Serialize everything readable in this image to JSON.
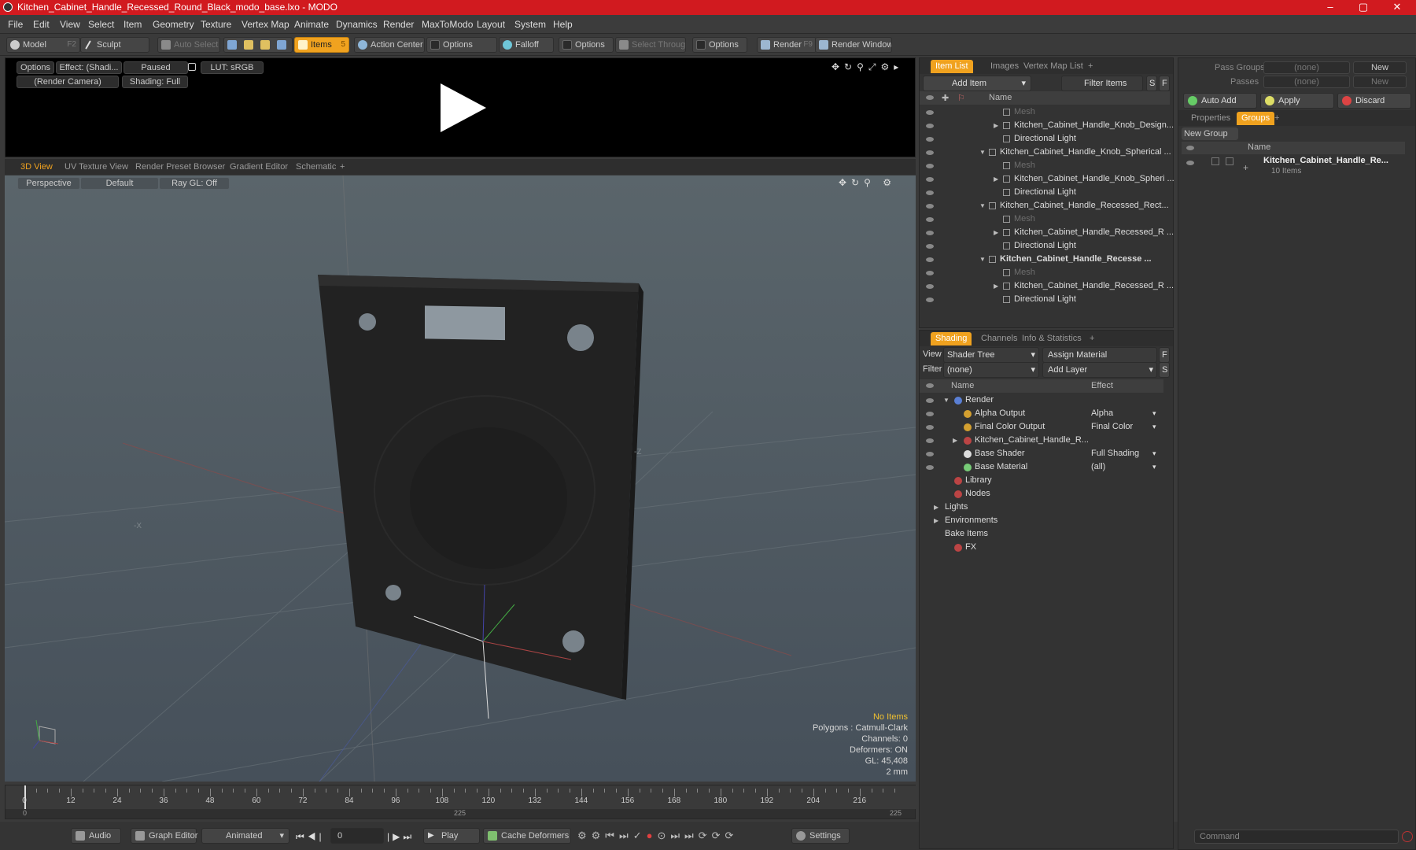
{
  "window": {
    "title": "Kitchen_Cabinet_Handle_Recessed_Round_Black_modo_base.lxo - MODO",
    "minimize": "–",
    "maximize": "▢",
    "close": "✕"
  },
  "menu": [
    "File",
    "Edit",
    "View",
    "Select",
    "Item",
    "Geometry",
    "Texture",
    "Vertex Map",
    "Animate",
    "Dynamics",
    "Render",
    "MaxToModo",
    "Layout",
    "System",
    "Help"
  ],
  "toolbar": {
    "model": "Model",
    "model_key": "F2",
    "sculpt": "Sculpt",
    "auto_select": "Auto Select",
    "items": "Items",
    "items_key": "5",
    "action_center": "Action Center",
    "options1": "Options",
    "falloff": "Falloff",
    "options2": "Options",
    "select_through": "Select Through",
    "options3": "Options",
    "render": "Render",
    "render_key": "F9",
    "render_window": "Render Window"
  },
  "preview": {
    "options": "Options",
    "effect": "Effect: (Shadi...",
    "paused": "Paused",
    "lut": "LUT: sRGB",
    "camera": "(Render Camera)",
    "shading": "Shading: Full"
  },
  "viewport_tabs": [
    "3D View",
    "UV Texture View",
    "Render Preset Browser",
    "Gradient Editor",
    "Schematic",
    "+"
  ],
  "viewport": {
    "perspective": "Perspective",
    "default": "Default",
    "raygl": "Ray GL: Off"
  },
  "stats": {
    "no_items": "No Items",
    "polygons": "Polygons : Catmull-Clark",
    "channels": "Channels: 0",
    "deformers": "Deformers: ON",
    "gl": "GL: 45,408",
    "size": "2 mm"
  },
  "timeline": {
    "labels": [
      "0",
      "12",
      "24",
      "36",
      "48",
      "60",
      "72",
      "84",
      "96",
      "108",
      "120",
      "132",
      "144",
      "156",
      "168",
      "180",
      "192",
      "204",
      "216"
    ],
    "start": "0",
    "mid": "225",
    "end": "225"
  },
  "bottom": {
    "audio": "Audio",
    "graph_editor": "Graph Editor",
    "animated": "Animated",
    "frame": "0",
    "play": "Play",
    "cache": "Cache Deformers",
    "settings": "Settings"
  },
  "item_list": {
    "tabs": [
      "Item List",
      "Images",
      "Vertex Map List",
      "+"
    ],
    "add_item": "Add Item",
    "filter": "Filter Items",
    "s": "S",
    "f": "F",
    "col_name": "Name",
    "rows": [
      {
        "text": "Mesh",
        "dim": true,
        "indent": 2
      },
      {
        "text": "Kitchen_Cabinet_Handle_Knob_Design...",
        "indent": 2,
        "arrow": "▶"
      },
      {
        "text": "Directional Light",
        "indent": 2
      },
      {
        "text": "Kitchen_Cabinet_Handle_Knob_Spherical ...",
        "indent": 1,
        "arrow": "▼"
      },
      {
        "text": "Mesh",
        "dim": true,
        "indent": 2
      },
      {
        "text": "Kitchen_Cabinet_Handle_Knob_Spheri ...",
        "indent": 2,
        "arrow": "▶"
      },
      {
        "text": "Directional Light",
        "indent": 2
      },
      {
        "text": "Kitchen_Cabinet_Handle_Recessed_Rect...",
        "indent": 1,
        "arrow": "▼"
      },
      {
        "text": "Mesh",
        "dim": true,
        "indent": 2
      },
      {
        "text": "Kitchen_Cabinet_Handle_Recessed_R ...",
        "indent": 2,
        "arrow": "▶"
      },
      {
        "text": "Directional Light",
        "indent": 2
      },
      {
        "text": "Kitchen_Cabinet_Handle_Recesse ...",
        "indent": 1,
        "arrow": "▼",
        "bold": true
      },
      {
        "text": "Mesh",
        "dim": true,
        "indent": 2
      },
      {
        "text": "Kitchen_Cabinet_Handle_Recessed_R ...",
        "indent": 2,
        "arrow": "▶"
      },
      {
        "text": "Directional Light",
        "indent": 2
      }
    ]
  },
  "shading": {
    "tabs": [
      "Shading",
      "Channels",
      "Info & Statistics",
      "+"
    ],
    "view_label": "View",
    "view_value": "Shader Tree",
    "assign": "Assign Material",
    "f": "F",
    "filter_label": "Filter",
    "filter_value": "(none)",
    "add_layer": "Add Layer",
    "s": "S",
    "col_name": "Name",
    "col_effect": "Effect",
    "rows": [
      {
        "name": "Render",
        "effect": "",
        "indent": 0,
        "arrow": "▼"
      },
      {
        "name": "Alpha Output",
        "effect": "Alpha",
        "indent": 1
      },
      {
        "name": "Final Color Output",
        "effect": "Final Color",
        "indent": 1
      },
      {
        "name": "Kitchen_Cabinet_Handle_R...",
        "effect": "",
        "indent": 1,
        "arrow": "▶"
      },
      {
        "name": "Base Shader",
        "effect": "Full Shading",
        "indent": 1
      },
      {
        "name": "Base Material",
        "effect": "(all)",
        "indent": 1
      },
      {
        "name": "Library",
        "effect": "",
        "indent": 0
      },
      {
        "name": "Nodes",
        "effect": "",
        "indent": 0
      },
      {
        "name": "Lights",
        "effect": "",
        "indent": -1,
        "arrow": "▶"
      },
      {
        "name": "Environments",
        "effect": "",
        "indent": -1,
        "arrow": "▶"
      },
      {
        "name": "Bake Items",
        "effect": "",
        "indent": -1
      },
      {
        "name": "FX",
        "effect": "",
        "indent": 0
      }
    ]
  },
  "right": {
    "pass_groups": "Pass Groups",
    "passes": "Passes",
    "none": "(none)",
    "new": "New",
    "auto_add": "Auto Add",
    "apply": "Apply",
    "discard": "Discard",
    "tabs": [
      "Properties",
      "Groups",
      "+"
    ],
    "new_group": "New Group",
    "col_name": "Name",
    "group_name": "Kitchen_Cabinet_Handle_Re...",
    "group_count": "10 Items",
    "command": "Command"
  },
  "axes": {
    "x": "-X",
    "z": "-Z"
  }
}
